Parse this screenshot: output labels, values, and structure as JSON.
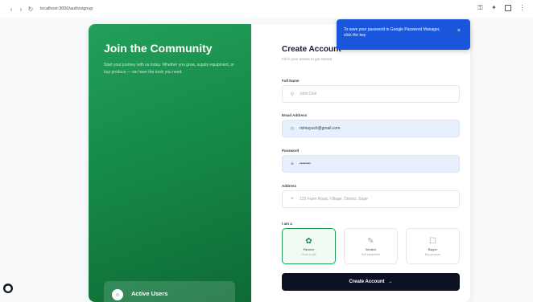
{
  "browser": {
    "url": "localhost:3000/auth/signup",
    "back_icon": "back-arrow-icon",
    "forward_icon": "forward-arrow-icon",
    "reload_icon": "reload-icon"
  },
  "popup": {
    "text": "To save your password in Google Password Manager, click the key",
    "close": "×"
  },
  "left_panel": {
    "title": "Join the Community",
    "description": "Start your journey with us today. Whether you grow, supply equipment, or buy produce — we have the tools you need.",
    "active_users_label": "Active Users",
    "avatar_glyph": "☺"
  },
  "form": {
    "title": "Create Account",
    "subtitle": "Fill in your details to get started",
    "full_name": {
      "label": "Full Name",
      "placeholder": "John Doe",
      "icon": "user-icon"
    },
    "email": {
      "label": "Email Address",
      "value": "rishiayush@gmail.com",
      "icon": "mail-icon"
    },
    "password": {
      "label": "Password",
      "value": "••••••••",
      "icon": "lock-icon"
    },
    "address": {
      "label": "Address",
      "placeholder": "123 Farm Road, Village, District, State",
      "icon": "location-icon"
    },
    "role_label": "I am a",
    "roles": [
      {
        "name": "Farmer",
        "desc": "Grow & sell",
        "icon": "leaf-icon",
        "glyph": "✿",
        "active": true
      },
      {
        "name": "Vendor",
        "desc": "Sell equipment",
        "icon": "wrench-icon",
        "glyph": "✎",
        "active": false
      },
      {
        "name": "Buyer",
        "desc": "Buy produce",
        "icon": "cart-icon",
        "glyph": "☐",
        "active": false
      }
    ],
    "submit_label": "Create Account",
    "submit_arrow": "→"
  },
  "colors": {
    "brand_green": "#168a47",
    "popup_blue": "#1a56db",
    "button_dark": "#0b1120",
    "autofill_bg": "#e8f0fe"
  }
}
